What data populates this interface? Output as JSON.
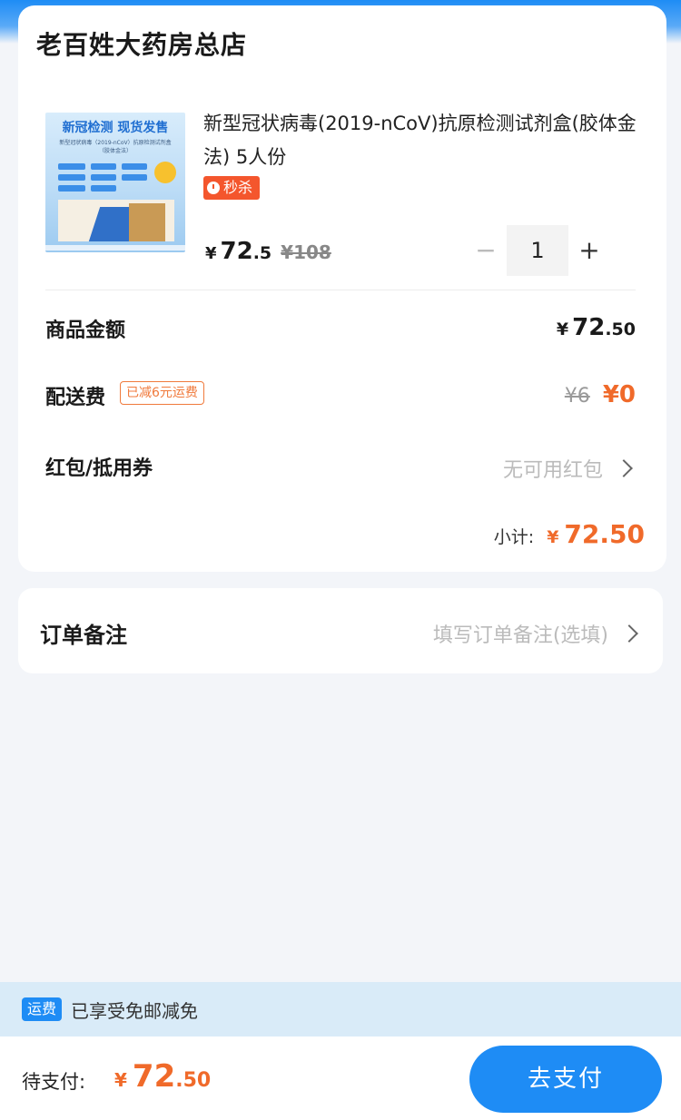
{
  "store": {
    "name": "老百姓大药房总店"
  },
  "product": {
    "thumb_title": "新冠检测 现货发售",
    "thumb_subtitle": "新型冠状病毒（2019-nCoV）抗原检测试剂盒（胶体金法）",
    "name": "新型冠状病毒(2019-nCoV)抗原检测试剂盒(胶体金法) 5人份",
    "flash_tag": "秒杀",
    "currency": "¥",
    "price_int": "72",
    "price_dec": ".5",
    "original_price": "¥108",
    "quantity": "1",
    "minus": "−",
    "plus": "+"
  },
  "summary": {
    "goods_label": "商品金额",
    "goods_currency": "¥",
    "goods_int": "72",
    "goods_dec": ".50",
    "shipping_label": "配送费",
    "shipping_tag": "已减6元运费",
    "shipping_old": "¥6",
    "shipping_new": "¥0",
    "coupon_label": "红包/抵用券",
    "coupon_value": "无可用红包",
    "subtotal_label": "小计:",
    "subtotal_currency": "¥",
    "subtotal_value": "72.50"
  },
  "note": {
    "label": "订单备注",
    "placeholder": "填写订单备注(选填)"
  },
  "free_shipping": {
    "tag": "运费",
    "text": "已享受免邮减免"
  },
  "footer": {
    "pay_label": "待支付:",
    "currency": "¥",
    "amount_int": "72",
    "amount_dec": ".50",
    "pay_button": "去支付"
  },
  "colors": {
    "accent": "#1e8cf5",
    "price": "#f06a2a",
    "flash": "#f4562d"
  }
}
